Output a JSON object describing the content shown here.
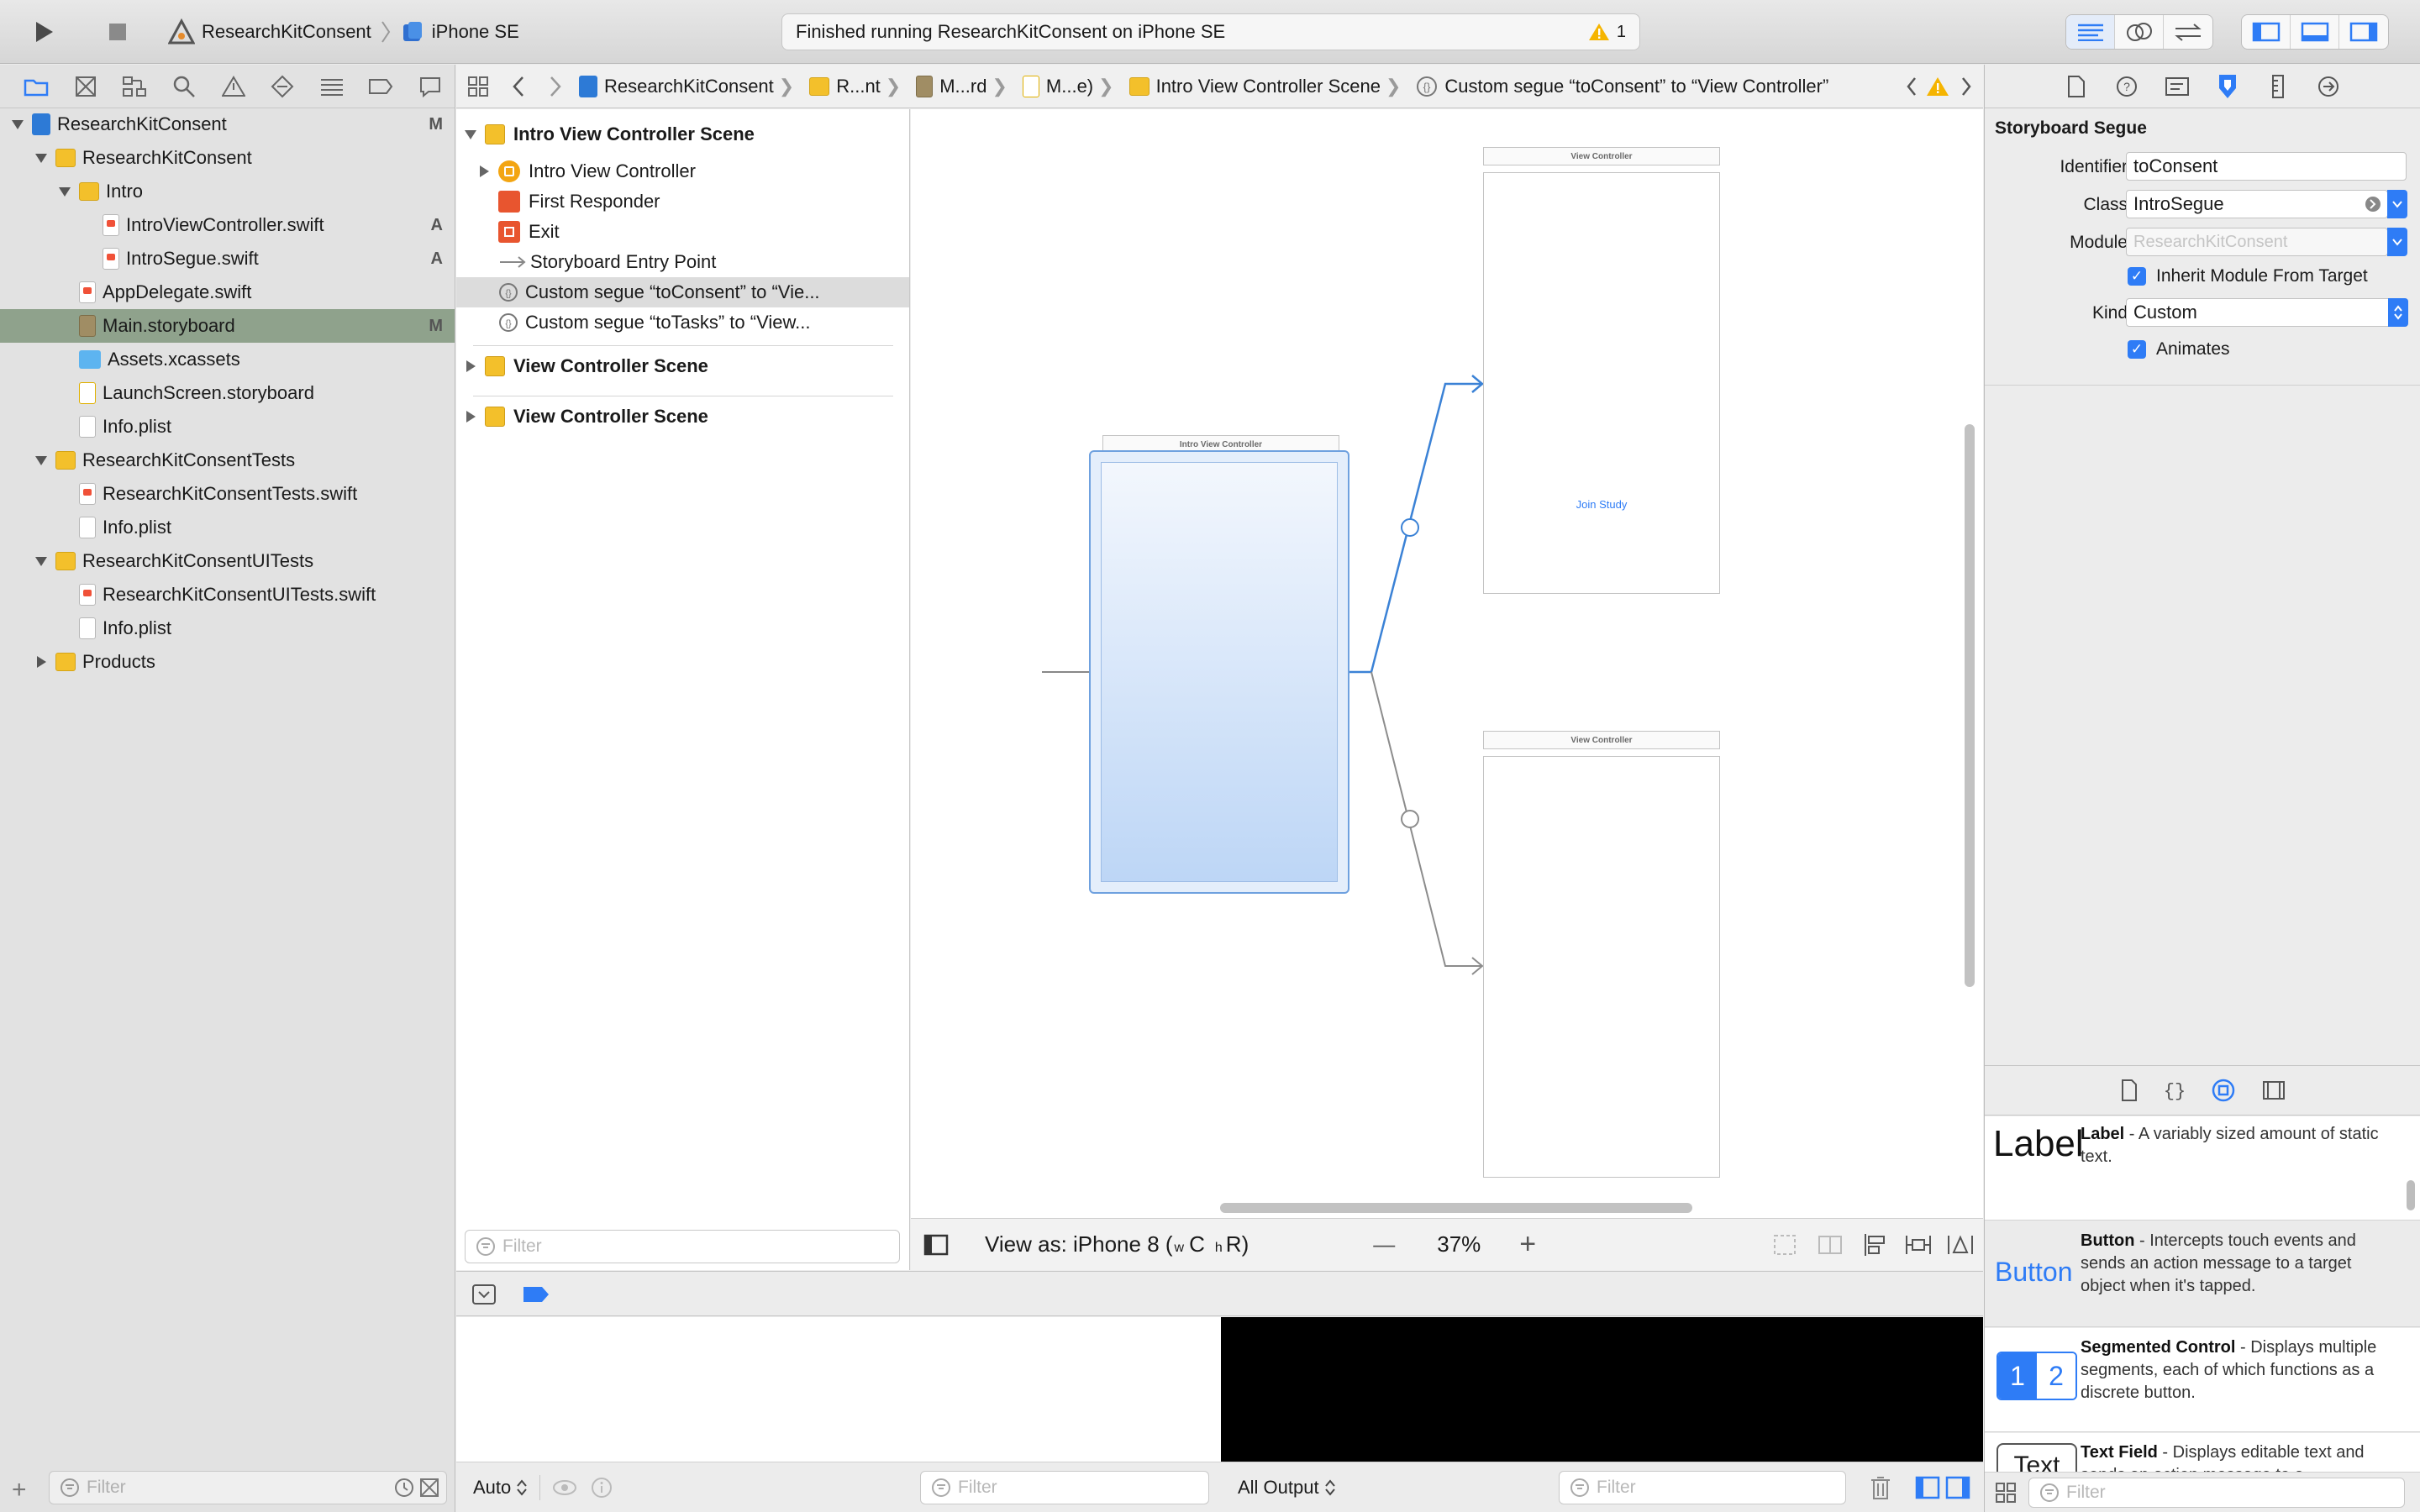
{
  "toolbar": {
    "scheme_project": "ResearchKitConsent",
    "scheme_device": "iPhone SE",
    "activity_status": "Finished running ResearchKitConsent on iPhone SE",
    "warning_count": "1"
  },
  "navigator": {
    "tree": [
      {
        "label": "ResearchKitConsent",
        "badge": "M"
      },
      {
        "label": "ResearchKitConsent",
        "badge": ""
      },
      {
        "label": "Intro",
        "badge": ""
      },
      {
        "label": "IntroViewController.swift",
        "badge": "A"
      },
      {
        "label": "IntroSegue.swift",
        "badge": "A"
      },
      {
        "label": "AppDelegate.swift",
        "badge": ""
      },
      {
        "label": "Main.storyboard",
        "badge": "M"
      },
      {
        "label": "Assets.xcassets",
        "badge": ""
      },
      {
        "label": "LaunchScreen.storyboard",
        "badge": ""
      },
      {
        "label": "Info.plist",
        "badge": ""
      },
      {
        "label": "ResearchKitConsentTests",
        "badge": ""
      },
      {
        "label": "ResearchKitConsentTests.swift",
        "badge": ""
      },
      {
        "label": "Info.plist",
        "badge": ""
      },
      {
        "label": "ResearchKitConsentUITests",
        "badge": ""
      },
      {
        "label": "ResearchKitConsentUITests.swift",
        "badge": ""
      },
      {
        "label": "Info.plist",
        "badge": ""
      },
      {
        "label": "Products",
        "badge": ""
      }
    ],
    "filter_placeholder": "Filter"
  },
  "jumpbar": {
    "crumbs": [
      "ResearchKitConsent",
      "R...nt",
      "M...rd",
      "M...e)",
      "Intro View Controller Scene",
      "Custom segue “toConsent” to “View Controller”"
    ]
  },
  "outline": {
    "scene1": "Intro View Controller Scene",
    "items": [
      "Intro View Controller",
      "First Responder",
      "Exit",
      "Storyboard Entry Point",
      "Custom segue “toConsent” to “Vie...",
      "Custom segue “toTasks” to “View..."
    ],
    "scene2": "View Controller Scene",
    "scene3": "View Controller Scene",
    "filter_placeholder": "Filter"
  },
  "canvas": {
    "intro_vc_title": "Intro View Controller",
    "vc1_title": "View Controller",
    "vc1_button": "Join Study",
    "vc2_title": "View Controller",
    "view_as": "View as: iPhone 8 (",
    "size_w": "w",
    "size_c": "C",
    "size_h": "h",
    "size_r": "R)",
    "zoom": "37%",
    "zoom_minus": "—",
    "zoom_plus": "+"
  },
  "debug": {
    "auto_label": "Auto",
    "filter_placeholder": "Filter",
    "output_label": "All Output",
    "console_filter_placeholder": "Filter"
  },
  "inspector": {
    "section_title": "Storyboard Segue",
    "identifier_label": "Identifier",
    "identifier_value": "toConsent",
    "class_label": "Class",
    "class_value": "IntroSegue",
    "module_label": "Module",
    "module_placeholder": "ResearchKitConsent",
    "inherit_label": "Inherit Module From Target",
    "kind_label": "Kind",
    "kind_value": "Custom",
    "animates_label": "Animates"
  },
  "library": {
    "items": [
      {
        "preview": "Label",
        "name": "Label",
        "desc": " - A variably sized amount of static text."
      },
      {
        "preview": "Button",
        "name": "Button",
        "desc": " - Intercepts touch events and sends an action message to a target object when it's tapped."
      },
      {
        "preview": "",
        "name": "Segmented Control",
        "desc": " - Displays multiple segments, each of which functions as a discrete button."
      },
      {
        "preview": "Text",
        "name": "Text Field",
        "desc": " - Displays editable text and sends an action message to a"
      }
    ],
    "seg_preview_1": "1",
    "seg_preview_2": "2",
    "filter_placeholder": "Filter"
  },
  "colors": {
    "selection_green": "#8fa28c",
    "accent_blue": "#2e7cf6",
    "folder_yellow": "#f3c02b"
  }
}
